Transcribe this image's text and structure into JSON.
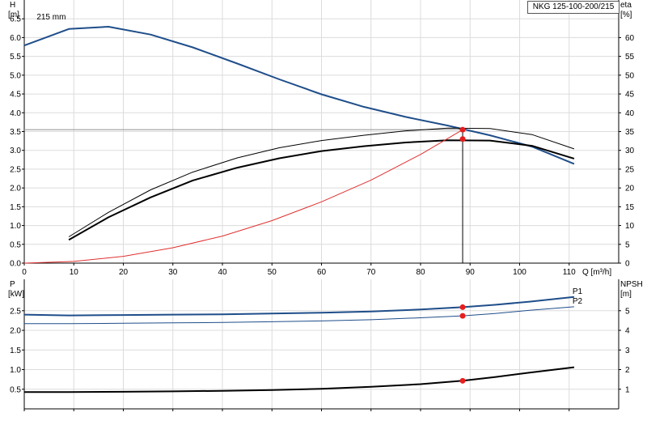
{
  "model": "NKG 125-100-200/215",
  "chart_data": [
    {
      "type": "line",
      "panel": "upper",
      "xlabel": "Q [m³/h]",
      "ylabel": "H",
      "ylabel_unit": "[m]",
      "y2label": "eta",
      "y2label_unit": "[%]",
      "xlim": [
        0,
        120
      ],
      "ylim": [
        0,
        7
      ],
      "y2lim": [
        0,
        70
      ],
      "grid": true,
      "x_ticks": [
        0,
        10,
        20,
        30,
        40,
        50,
        60,
        70,
        80,
        90,
        100,
        110
      ],
      "y_ticks": [
        0.0,
        0.5,
        1.0,
        1.5,
        2.0,
        2.5,
        3.0,
        3.5,
        4.0,
        4.5,
        5.0,
        5.5,
        6.0,
        6.5
      ],
      "y_tick_labels": [
        "0.0",
        "0.5",
        "1.0",
        "1.5",
        "2.0",
        "2.5",
        "3.0",
        "3.5",
        "4.0",
        "4.5",
        "5.0",
        "5.5",
        "6.0",
        "6.5"
      ],
      "y2_ticks": [
        0,
        5,
        10,
        15,
        20,
        25,
        30,
        35,
        40,
        45,
        50,
        55,
        60
      ],
      "annotations": [
        {
          "text": "215 mm",
          "x": 2.5,
          "y": 6.48
        }
      ],
      "series": [
        {
          "role": "head",
          "color": "#1f4e8a",
          "width": 2,
          "x": [
            0,
            9,
            17,
            25.5,
            34,
            43,
            51.5,
            60,
            68.5,
            77,
            85.5,
            94,
            102.5,
            111
          ],
          "y": [
            5.79,
            6.23,
            6.29,
            6.08,
            5.74,
            5.31,
            4.89,
            4.49,
            4.16,
            3.89,
            3.66,
            3.4,
            3.1,
            2.64
          ]
        },
        {
          "role": "efficiency",
          "axis": "y2",
          "color": "#000000",
          "width": 1,
          "x": [
            9,
            17,
            25.5,
            34,
            43,
            51.5,
            60,
            68.5,
            77,
            85.5,
            94,
            102.5,
            111
          ],
          "y": [
            7.0,
            13.5,
            19.5,
            24.2,
            28.0,
            30.7,
            32.6,
            34.0,
            35.2,
            35.9,
            35.8,
            34.2,
            30.4
          ]
        },
        {
          "role": "efficiency-hydraulic",
          "axis": "y2",
          "color": "#000000",
          "width": 2,
          "x": [
            9,
            17,
            25.5,
            34,
            43,
            51.5,
            60,
            68.5,
            77,
            85.5,
            94,
            102.5,
            111
          ],
          "y": [
            6.2,
            12.2,
            17.5,
            22.0,
            25.4,
            27.9,
            29.8,
            31.1,
            32.1,
            32.7,
            32.6,
            31.2,
            27.8
          ]
        },
        {
          "role": "system",
          "color": "#e03030",
          "width": 1,
          "x": [
            0,
            10,
            20,
            30,
            40,
            50,
            60,
            70,
            80,
            88.5
          ],
          "y": [
            0.0,
            0.045,
            0.18,
            0.41,
            0.72,
            1.13,
            1.63,
            2.21,
            2.89,
            3.55
          ]
        }
      ],
      "duty_point": {
        "x": 88.5,
        "y": 3.55,
        "eta": 33
      }
    },
    {
      "type": "line",
      "panel": "lower",
      "ylabel": "P",
      "ylabel_unit": "[kW]",
      "y2label": "NPSH",
      "y2label_unit": "[m]",
      "xlim": [
        0,
        120
      ],
      "ylim": [
        0,
        3.3
      ],
      "y2lim": [
        0,
        6.6
      ],
      "grid": true,
      "x_ticks": [
        0,
        10,
        20,
        30,
        40,
        50,
        60,
        70,
        80,
        90,
        100,
        110
      ],
      "y_ticks": [
        0.5,
        1.0,
        1.5,
        2.0,
        2.5
      ],
      "y_tick_labels": [
        "0.5",
        "1.0",
        "1.5",
        "2.0",
        "2.5"
      ],
      "y2_ticks": [
        1,
        2,
        3,
        4,
        5
      ],
      "series": [
        {
          "name": "P1",
          "color": "#1f4e8a",
          "width": 2,
          "x": [
            0,
            9,
            20,
            30,
            40,
            50,
            60,
            70,
            80,
            88.5,
            95,
            102,
            111
          ],
          "y": [
            2.4,
            2.38,
            2.39,
            2.4,
            2.41,
            2.43,
            2.45,
            2.48,
            2.53,
            2.59,
            2.65,
            2.73,
            2.85
          ]
        },
        {
          "name": "P2",
          "color": "#1f4e8a",
          "width": 1,
          "x": [
            0,
            9,
            20,
            30,
            40,
            50,
            60,
            70,
            80,
            88.5,
            95,
            102,
            111
          ],
          "y": [
            2.17,
            2.17,
            2.18,
            2.19,
            2.2,
            2.22,
            2.24,
            2.27,
            2.32,
            2.37,
            2.43,
            2.51,
            2.6
          ]
        },
        {
          "role": "npsh",
          "axis": "y2",
          "color": "#000000",
          "width": 2,
          "x": [
            0,
            9,
            20,
            30,
            40,
            50,
            60,
            70,
            80,
            88.5,
            95,
            102,
            111
          ],
          "y": [
            0.86,
            0.86,
            0.87,
            0.89,
            0.92,
            0.96,
            1.02,
            1.12,
            1.26,
            1.43,
            1.62,
            1.85,
            2.12
          ]
        }
      ],
      "duty_points": [
        {
          "series": "P1",
          "x": 88.5,
          "y": 2.59
        },
        {
          "series": "P2",
          "x": 88.5,
          "y": 2.37
        },
        {
          "series": "npsh",
          "x": 88.5,
          "y2": 1.43
        }
      ]
    }
  ]
}
